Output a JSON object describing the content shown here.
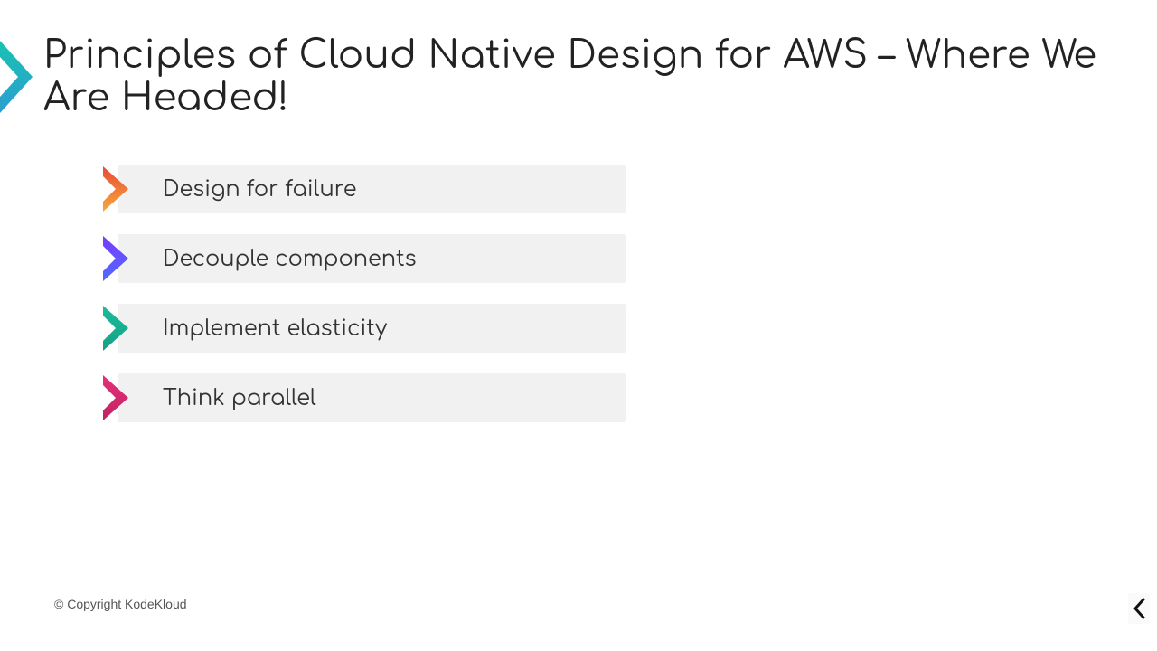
{
  "slide": {
    "title": "Principles of Cloud Native Design for AWS – Where We Are Headed!",
    "principles": [
      {
        "label": "Design for failure",
        "gradient": [
          "#e94b35",
          "#f6a83c"
        ]
      },
      {
        "label": "Decouple components",
        "gradient": [
          "#7a3bff",
          "#4f6bff"
        ]
      },
      {
        "label": "Implement elasticity",
        "gradient": [
          "#1abc9c",
          "#16a085"
        ]
      },
      {
        "label": "Think parallel",
        "gradient": [
          "#e6317a",
          "#c02362"
        ]
      }
    ],
    "footer": "© Copyright KodeKloud"
  }
}
